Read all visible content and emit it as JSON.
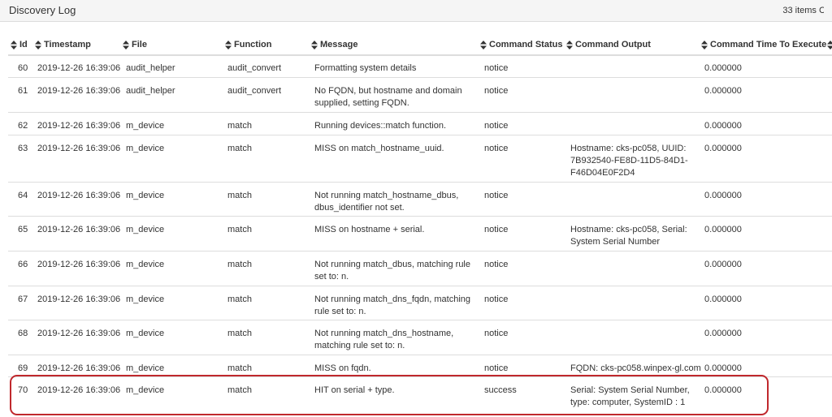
{
  "panel": {
    "title": "Discovery Log",
    "items_count": "33 items",
    "items_count_extra": "C"
  },
  "colors": {
    "highlight_border": "#c0282d",
    "row_border": "#dddddd",
    "header_bg": "#f5f5f5"
  },
  "columns": [
    {
      "key": "id",
      "label": "Id"
    },
    {
      "key": "timestamp",
      "label": "Timestamp"
    },
    {
      "key": "file",
      "label": "File"
    },
    {
      "key": "function",
      "label": "Function"
    },
    {
      "key": "message",
      "label": "Message"
    },
    {
      "key": "command_status",
      "label": "Command Status"
    },
    {
      "key": "command_output",
      "label": "Command Output"
    },
    {
      "key": "command_time",
      "label": "Command Time To Execute"
    }
  ],
  "rows": [
    {
      "id": "60",
      "timestamp": "2019-12-26 16:39:06",
      "file": "audit_helper",
      "function": "audit_convert",
      "message": "Formatting system details",
      "status": "notice",
      "output": "",
      "time": "0.000000"
    },
    {
      "id": "61",
      "timestamp": "2019-12-26 16:39:06",
      "file": "audit_helper",
      "function": "audit_convert",
      "message": "No FQDN, but hostname and domain supplied, setting FQDN.",
      "status": "notice",
      "output": "",
      "time": "0.000000"
    },
    {
      "id": "62",
      "timestamp": "2019-12-26 16:39:06",
      "file": "m_device",
      "function": "match",
      "message": "Running devices::match function.",
      "status": "notice",
      "output": "",
      "time": "0.000000"
    },
    {
      "id": "63",
      "timestamp": "2019-12-26 16:39:06",
      "file": "m_device",
      "function": "match",
      "message": "MISS on match_hostname_uuid.",
      "status": "notice",
      "output": "Hostname: cks-pc058, UUID: 7B932540-FE8D-11D5-84D1-F46D04E0F2D4",
      "time": "0.000000"
    },
    {
      "id": "64",
      "timestamp": "2019-12-26 16:39:06",
      "file": "m_device",
      "function": "match",
      "message": "Not running match_hostname_dbus, dbus_identifier not set.",
      "status": "notice",
      "output": "",
      "time": "0.000000"
    },
    {
      "id": "65",
      "timestamp": "2019-12-26 16:39:06",
      "file": "m_device",
      "function": "match",
      "message": "MISS on hostname + serial.",
      "status": "notice",
      "output": "Hostname: cks-pc058, Serial: System Serial Number",
      "time": "0.000000"
    },
    {
      "id": "66",
      "timestamp": "2019-12-26 16:39:06",
      "file": "m_device",
      "function": "match",
      "message": "Not running match_dbus, matching rule set to: n.",
      "status": "notice",
      "output": "",
      "time": "0.000000"
    },
    {
      "id": "67",
      "timestamp": "2019-12-26 16:39:06",
      "file": "m_device",
      "function": "match",
      "message": "Not running match_dns_fqdn, matching rule set to: n.",
      "status": "notice",
      "output": "",
      "time": "0.000000"
    },
    {
      "id": "68",
      "timestamp": "2019-12-26 16:39:06",
      "file": "m_device",
      "function": "match",
      "message": "Not running match_dns_hostname, matching rule set to: n.",
      "status": "notice",
      "output": "",
      "time": "0.000000"
    },
    {
      "id": "69",
      "timestamp": "2019-12-26 16:39:06",
      "file": "m_device",
      "function": "match",
      "message": "MISS on fqdn.",
      "status": "notice",
      "output": "FQDN: cks-pc058.winpex-gl.com",
      "time": "0.000000"
    },
    {
      "id": "70",
      "timestamp": "2019-12-26 16:39:06",
      "file": "m_device",
      "function": "match",
      "message": "HIT on serial + type.",
      "status": "success",
      "output": "Serial: System Serial Number, type: computer, SystemID : 1",
      "time": "0.000000"
    }
  ]
}
